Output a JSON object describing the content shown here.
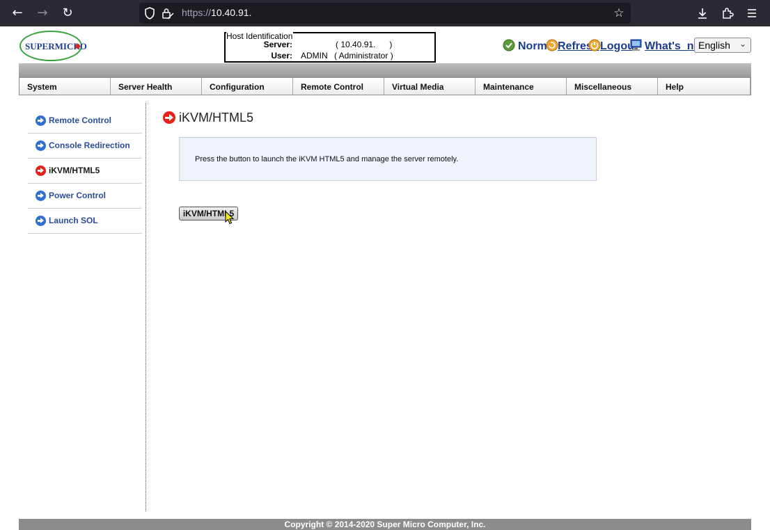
{
  "browser": {
    "url_protocol": "https://",
    "url_host": "10.40.91."
  },
  "header": {
    "logo_text": "SUPERMICRO",
    "host_identification": {
      "legend": "Host Identification",
      "server_label": "Server:",
      "server_value": "( 10.40.91.      )",
      "user_label": "User:",
      "user_name": "ADMIN",
      "user_role": "( Administrator )"
    },
    "status": "Normal",
    "links": {
      "refresh": "Refresh",
      "logout": "Logout",
      "whats_new": "What's_new"
    },
    "language": "English"
  },
  "menu": [
    {
      "label": "System"
    },
    {
      "label": "Server Health"
    },
    {
      "label": "Configuration"
    },
    {
      "label": "Remote Control"
    },
    {
      "label": "Virtual Media"
    },
    {
      "label": "Maintenance"
    },
    {
      "label": "Miscellaneous"
    },
    {
      "label": "Help"
    }
  ],
  "sidebar": {
    "items": [
      {
        "label": "Remote Control",
        "active": false
      },
      {
        "label": "Console Redirection",
        "active": false
      },
      {
        "label": "iKVM/HTML5",
        "active": true
      },
      {
        "label": "Power Control",
        "active": false
      },
      {
        "label": "Launch SOL",
        "active": false
      }
    ]
  },
  "main": {
    "title": "iKVM/HTML5",
    "info": "Press the button to launch the iKVM HTML5 and manage the server remotely.",
    "button_label": "iKVM/HTML5"
  },
  "footer": {
    "copyright": "Copyright © 2014-2020 Super Micro Computer, Inc."
  },
  "colors": {
    "link_blue": "#1b3c8c",
    "active_arrow": "#e52218",
    "inactive_arrow": "#2f6fd3",
    "browser_chrome": "#2b2a33"
  }
}
